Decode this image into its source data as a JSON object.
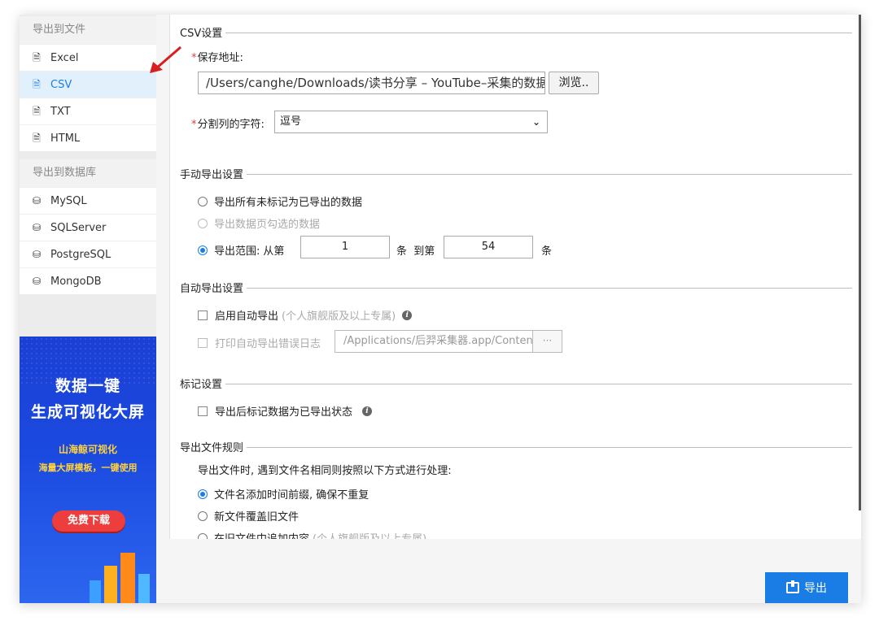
{
  "sidebar": {
    "file_group": {
      "header": "导出到文件",
      "items": [
        {
          "label": "Excel",
          "icon": "file-icon",
          "active": false
        },
        {
          "label": "CSV",
          "icon": "file-icon",
          "active": true
        },
        {
          "label": "TXT",
          "icon": "file-icon",
          "active": false
        },
        {
          "label": "HTML",
          "icon": "file-icon",
          "active": false
        }
      ]
    },
    "db_group": {
      "header": "导出到数据库",
      "items": [
        {
          "label": "MySQL",
          "icon": "database-icon"
        },
        {
          "label": "SQLServer",
          "icon": "database-icon"
        },
        {
          "label": "PostgreSQL",
          "icon": "database-icon"
        },
        {
          "label": "MongoDB",
          "icon": "database-icon"
        }
      ]
    },
    "banner": {
      "title1": "数据一键",
      "title2": "生成可视化大屏",
      "sub1": "山海鲸可视化",
      "sub2": "海量大屏模板，一键使用",
      "button": "免费下载"
    }
  },
  "csv_settings": {
    "section": "CSV设置",
    "required_mark": "*",
    "save_path_label": "保存地址:",
    "save_path_value": "/Users/canghe/Downloads/读书分享 – YouTube–采集的数据.csv",
    "browse_label": "浏览..",
    "separator_label": "分割列的字符:",
    "separator_value": "逗号"
  },
  "manual_export": {
    "section": "手动导出设置",
    "option_all": "导出所有未标记为已导出的数据",
    "option_selected": "导出数据页勾选的数据",
    "option_range": "导出范围:",
    "from_label": "从第",
    "from_value": "1",
    "unit1": "条",
    "to_label": "到第",
    "to_value": "54",
    "unit2": "条"
  },
  "auto_export": {
    "section": "自动导出设置",
    "enable_label": "启用自动导出",
    "enable_note": "(个人旗舰版及以上专属)",
    "log_label": "打印自动导出错误日志",
    "log_path": "/Applications/后羿采集器.app/Contents",
    "log_btn": "···"
  },
  "mark_settings": {
    "section": "标记设置",
    "mark_label": "导出后标记数据为已导出状态"
  },
  "file_rules": {
    "section": "导出文件规则",
    "description": "导出文件时, 遇到文件名相同则按照以下方式进行处理:",
    "option_prefix": "文件名添加时间前缀, 确保不重复",
    "option_overwrite": "新文件覆盖旧文件",
    "option_append": "在旧文件中追加内容",
    "option_append_note": "(个人旗舰版及以上专属)"
  },
  "footer": {
    "export_label": "导出"
  },
  "colors": {
    "accent": "#1a7de6",
    "required": "#e23c3c",
    "arrow": "#d81e1e"
  }
}
